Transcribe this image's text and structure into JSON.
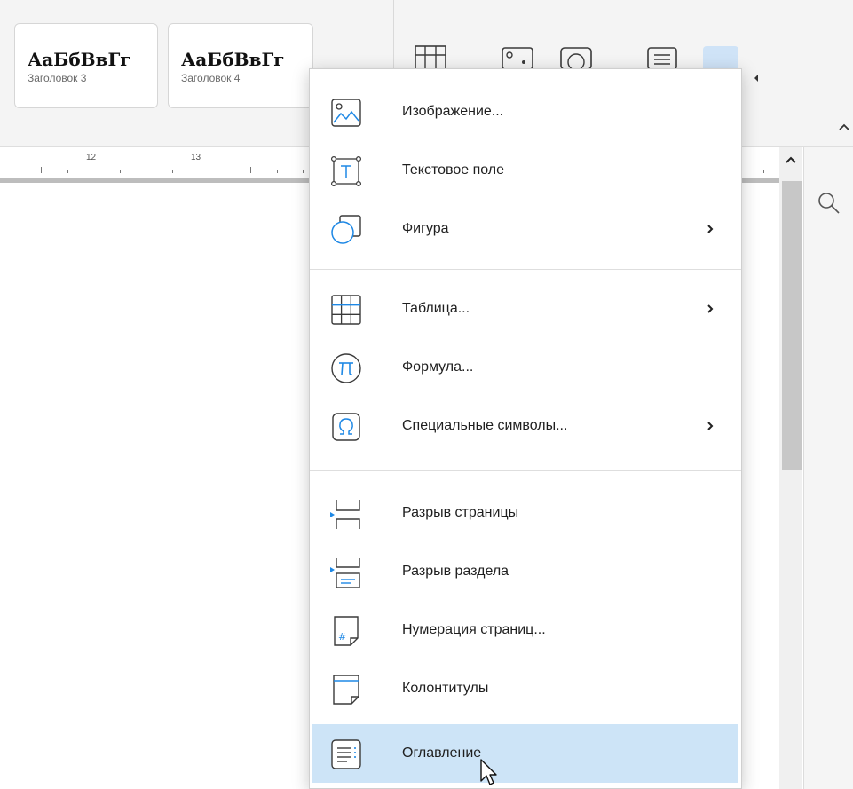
{
  "styles_gallery": [
    {
      "sample": "АаБбВвГг",
      "caption": "Заголовок 3"
    },
    {
      "sample": "АаБбВвГг",
      "caption": "Заголовок 4"
    }
  ],
  "ruler": {
    "labels": [
      "12",
      "13"
    ]
  },
  "insert_menu": {
    "items": [
      {
        "label": "Изображение...",
        "icon": "image-icon",
        "submenu": false
      },
      {
        "label": "Текстовое поле",
        "icon": "text-box-icon",
        "submenu": false
      },
      {
        "label": "Фигура",
        "icon": "shape-icon",
        "submenu": true
      },
      {
        "label": "Таблица...",
        "icon": "table-icon",
        "submenu": true
      },
      {
        "label": "Формула...",
        "icon": "formula-icon",
        "submenu": false
      },
      {
        "label": "Специальные символы...",
        "icon": "special-symbols-icon",
        "submenu": true
      },
      {
        "label": "Разрыв страницы",
        "icon": "page-break-icon",
        "submenu": false
      },
      {
        "label": "Разрыв раздела",
        "icon": "section-break-icon",
        "submenu": false
      },
      {
        "label": "Нумерация страниц...",
        "icon": "page-numbering-icon",
        "submenu": false
      },
      {
        "label": "Колонтитулы",
        "icon": "header-footer-icon",
        "submenu": false
      },
      {
        "label": "Оглавление",
        "icon": "table-of-contents-icon",
        "submenu": false,
        "highlighted": true
      }
    ]
  },
  "colors": {
    "highlight": "#cde4f7",
    "icon_stroke": "#3a3a3a",
    "accent_blue": "#1e88e5"
  }
}
